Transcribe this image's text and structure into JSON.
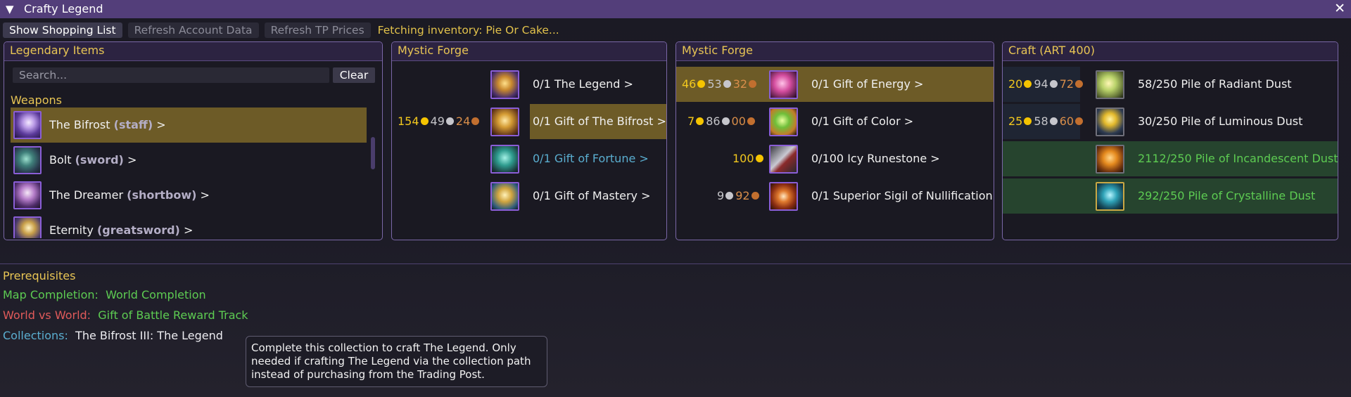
{
  "window": {
    "title": "Crafty Legend",
    "collapse_icon": "triangle-down-icon",
    "close_icon": "close-icon"
  },
  "toolbar": {
    "show_shopping_list": "Show Shopping List",
    "refresh_account": "Refresh Account Data",
    "refresh_tp": "Refresh TP Prices",
    "status": "Fetching inventory: Pie Or Cake..."
  },
  "legendary": {
    "title": "Legendary Items",
    "search_placeholder": "Search...",
    "clear": "Clear",
    "group": "Weapons",
    "items": [
      {
        "name": "The Bifrost",
        "type": "(staff)",
        "arrow": ">",
        "selected": true
      },
      {
        "name": "Bolt",
        "type": "(sword)",
        "arrow": ">"
      },
      {
        "name": "The Dreamer",
        "type": "(shortbow)",
        "arrow": ">"
      },
      {
        "name": "Eternity",
        "type": "(greatsword)",
        "arrow": ">"
      }
    ]
  },
  "forge1": {
    "title": "Mystic Forge",
    "rows": [
      {
        "label": "0/1 The Legend >",
        "cost": null,
        "highlight": false,
        "color": "white"
      },
      {
        "label": "0/1 Gift of The Bifrost >",
        "cost": {
          "gold": "154",
          "silver": "49",
          "copper": "24"
        },
        "highlight": true,
        "color": "white"
      },
      {
        "label": "0/1 Gift of Fortune >",
        "cost": null,
        "highlight": false,
        "color": "blue"
      },
      {
        "label": "0/1 Gift of Mastery >",
        "cost": null,
        "highlight": false,
        "color": "white"
      }
    ]
  },
  "forge2": {
    "title": "Mystic Forge",
    "rows": [
      {
        "label": "0/1 Gift of Energy >",
        "cost": {
          "gold": "46",
          "silver": "53",
          "copper": "32"
        },
        "highlight": true
      },
      {
        "label": "0/1 Gift of Color >",
        "cost": {
          "gold": "7",
          "silver": "86",
          "copper": "00"
        },
        "highlight": false
      },
      {
        "label": "0/100 Icy Runestone >",
        "cost": {
          "gold": "100"
        },
        "highlight": false
      },
      {
        "label": "0/1 Superior Sigil of Nullification",
        "cost": {
          "silver": "9",
          "copper": "92"
        },
        "highlight": false
      }
    ]
  },
  "craft": {
    "title": "Craft (ART 400)",
    "rows": [
      {
        "label": "58/250 Pile of Radiant Dust",
        "cost": {
          "gold": "20",
          "silver": "94",
          "copper": "72"
        },
        "complete": false
      },
      {
        "label": "30/250 Pile of Luminous Dust",
        "cost": {
          "gold": "25",
          "silver": "58",
          "copper": "60"
        },
        "complete": false
      },
      {
        "label": "2112/250 Pile of Incandescent Dust",
        "cost": null,
        "complete": true
      },
      {
        "label": "292/250 Pile of Crystalline Dust",
        "cost": null,
        "complete": true
      }
    ]
  },
  "prereq": {
    "title": "Prerequisites",
    "map_label": "Map Completion:",
    "map_value": "World Completion",
    "wvw_label": "World vs World:",
    "wvw_value": "Gift of Battle Reward Track",
    "coll_label": "Collections:",
    "coll_value": "The Bifrost III: The Legend"
  },
  "tooltip": {
    "line1": "Complete this collection to craft The Legend. Only",
    "line2": "needed if crafting The Legend via the collection path",
    "line3": "instead of purchasing from the Trading Post."
  },
  "colors": {
    "accent_purple": "#533e7a",
    "gold_text": "#e8c554",
    "highlight": "#6d5b27",
    "complete_green": "#5dcc52"
  }
}
